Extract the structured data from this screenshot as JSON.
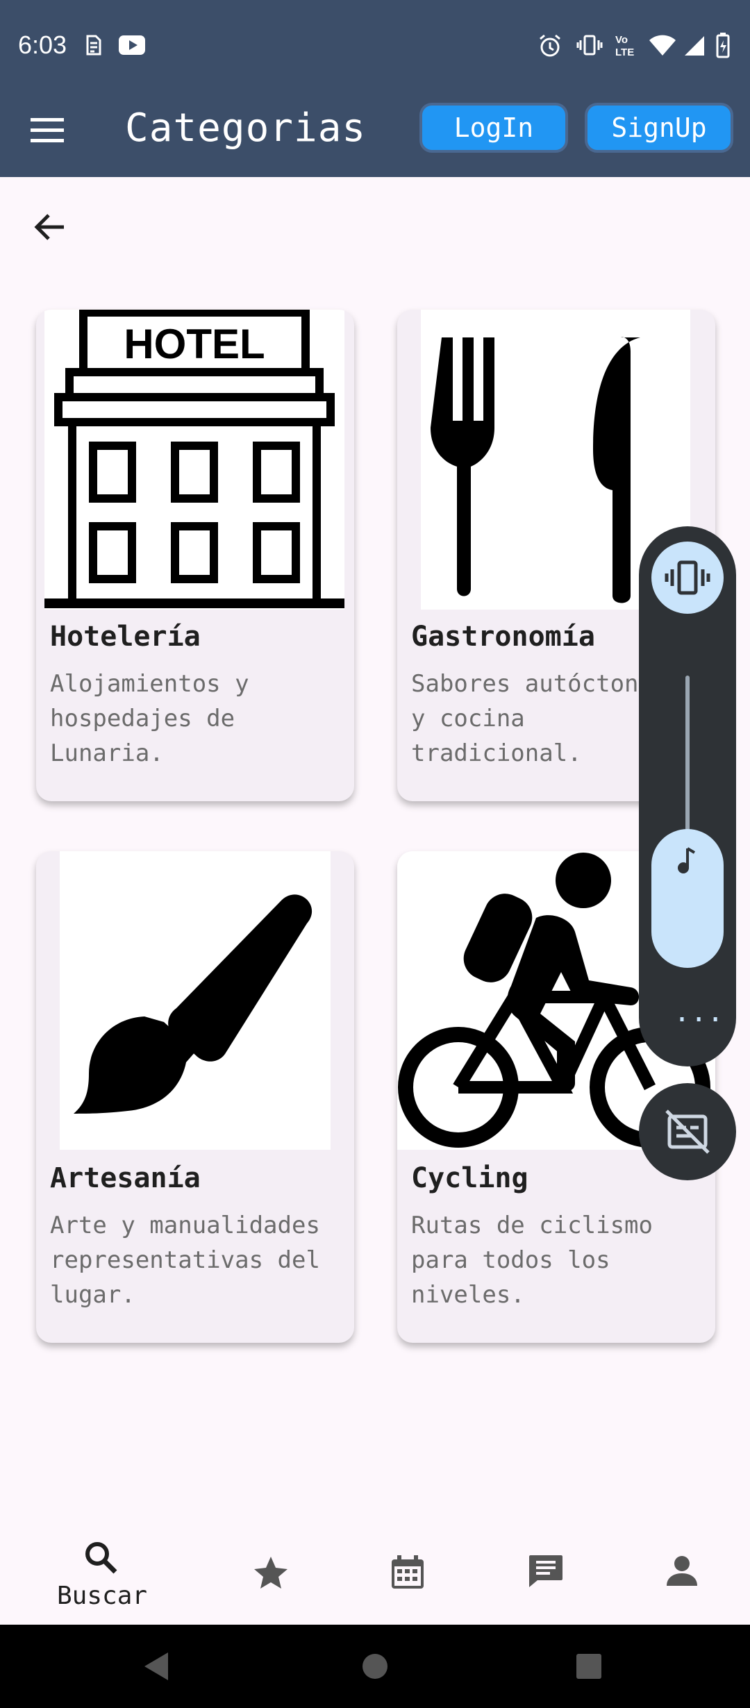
{
  "status_bar": {
    "time": "6:03",
    "icons": [
      "sim-icon",
      "youtube-icon",
      "alarm-icon",
      "vibrate-icon",
      "volte-icon",
      "wifi-icon",
      "signal-icon",
      "battery-icon"
    ]
  },
  "app_bar": {
    "title": "Categorias",
    "login_label": "LogIn",
    "signup_label": "SignUp"
  },
  "categories": [
    {
      "title": "Hotelería",
      "desc": [
        "Alojamientos y",
        "hospedajes de",
        "Lunaria."
      ],
      "image": "hotel-icon",
      "image_label": "HOTEL"
    },
    {
      "title": "Gastronomía",
      "desc": [
        "Sabores autóctonos",
        "y cocina",
        "tradicional."
      ],
      "image": "fork-knife-icon"
    },
    {
      "title": "Artesanía",
      "desc": [
        "Arte y manualidades",
        "representativas del",
        "lugar."
      ],
      "image": "paintbrush-icon"
    },
    {
      "title": "Cycling",
      "desc": [
        "Rutas de ciclismo",
        "para todos los",
        "niveles."
      ],
      "image": "cyclist-icon"
    }
  ],
  "volume_panel": {
    "more": "..."
  },
  "bottom_nav": {
    "items": [
      {
        "label": "Buscar",
        "icon": "search-icon"
      },
      {
        "label": "",
        "icon": "star-icon"
      },
      {
        "label": "",
        "icon": "calendar-icon"
      },
      {
        "label": "",
        "icon": "chat-icon"
      },
      {
        "label": "",
        "icon": "person-icon"
      }
    ]
  },
  "colors": {
    "app_bar": "#3c4e69",
    "button": "#2196f3",
    "background": "#fdf7fc",
    "card": "#f4eef5",
    "volume_panel": "#2e3236",
    "volume_accent": "#c9e4fb"
  }
}
